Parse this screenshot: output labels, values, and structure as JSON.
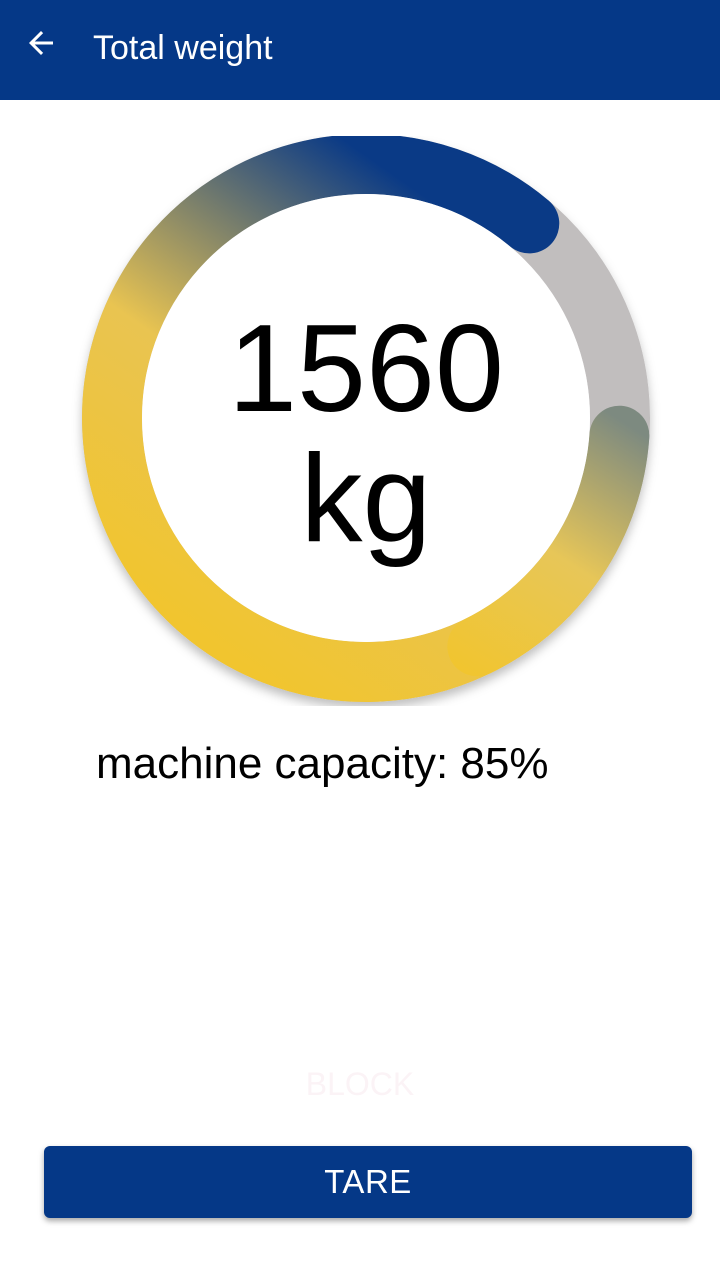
{
  "appbar": {
    "title": "Total weight",
    "back_icon": "arrow-left-icon"
  },
  "gauge": {
    "value": "1560",
    "unit": "kg",
    "capacity_fraction": 0.85,
    "colors": {
      "track": "#c1bebe",
      "start": "#f1c52f",
      "mid": "#f0c42d",
      "end": "#0a3a86"
    }
  },
  "capacity": {
    "text": "machine capacity: 85%"
  },
  "block_label": "BLOCK",
  "tare_button": {
    "label": "TARE"
  },
  "colors": {
    "primary": "#053887",
    "background": "#ffffff"
  }
}
